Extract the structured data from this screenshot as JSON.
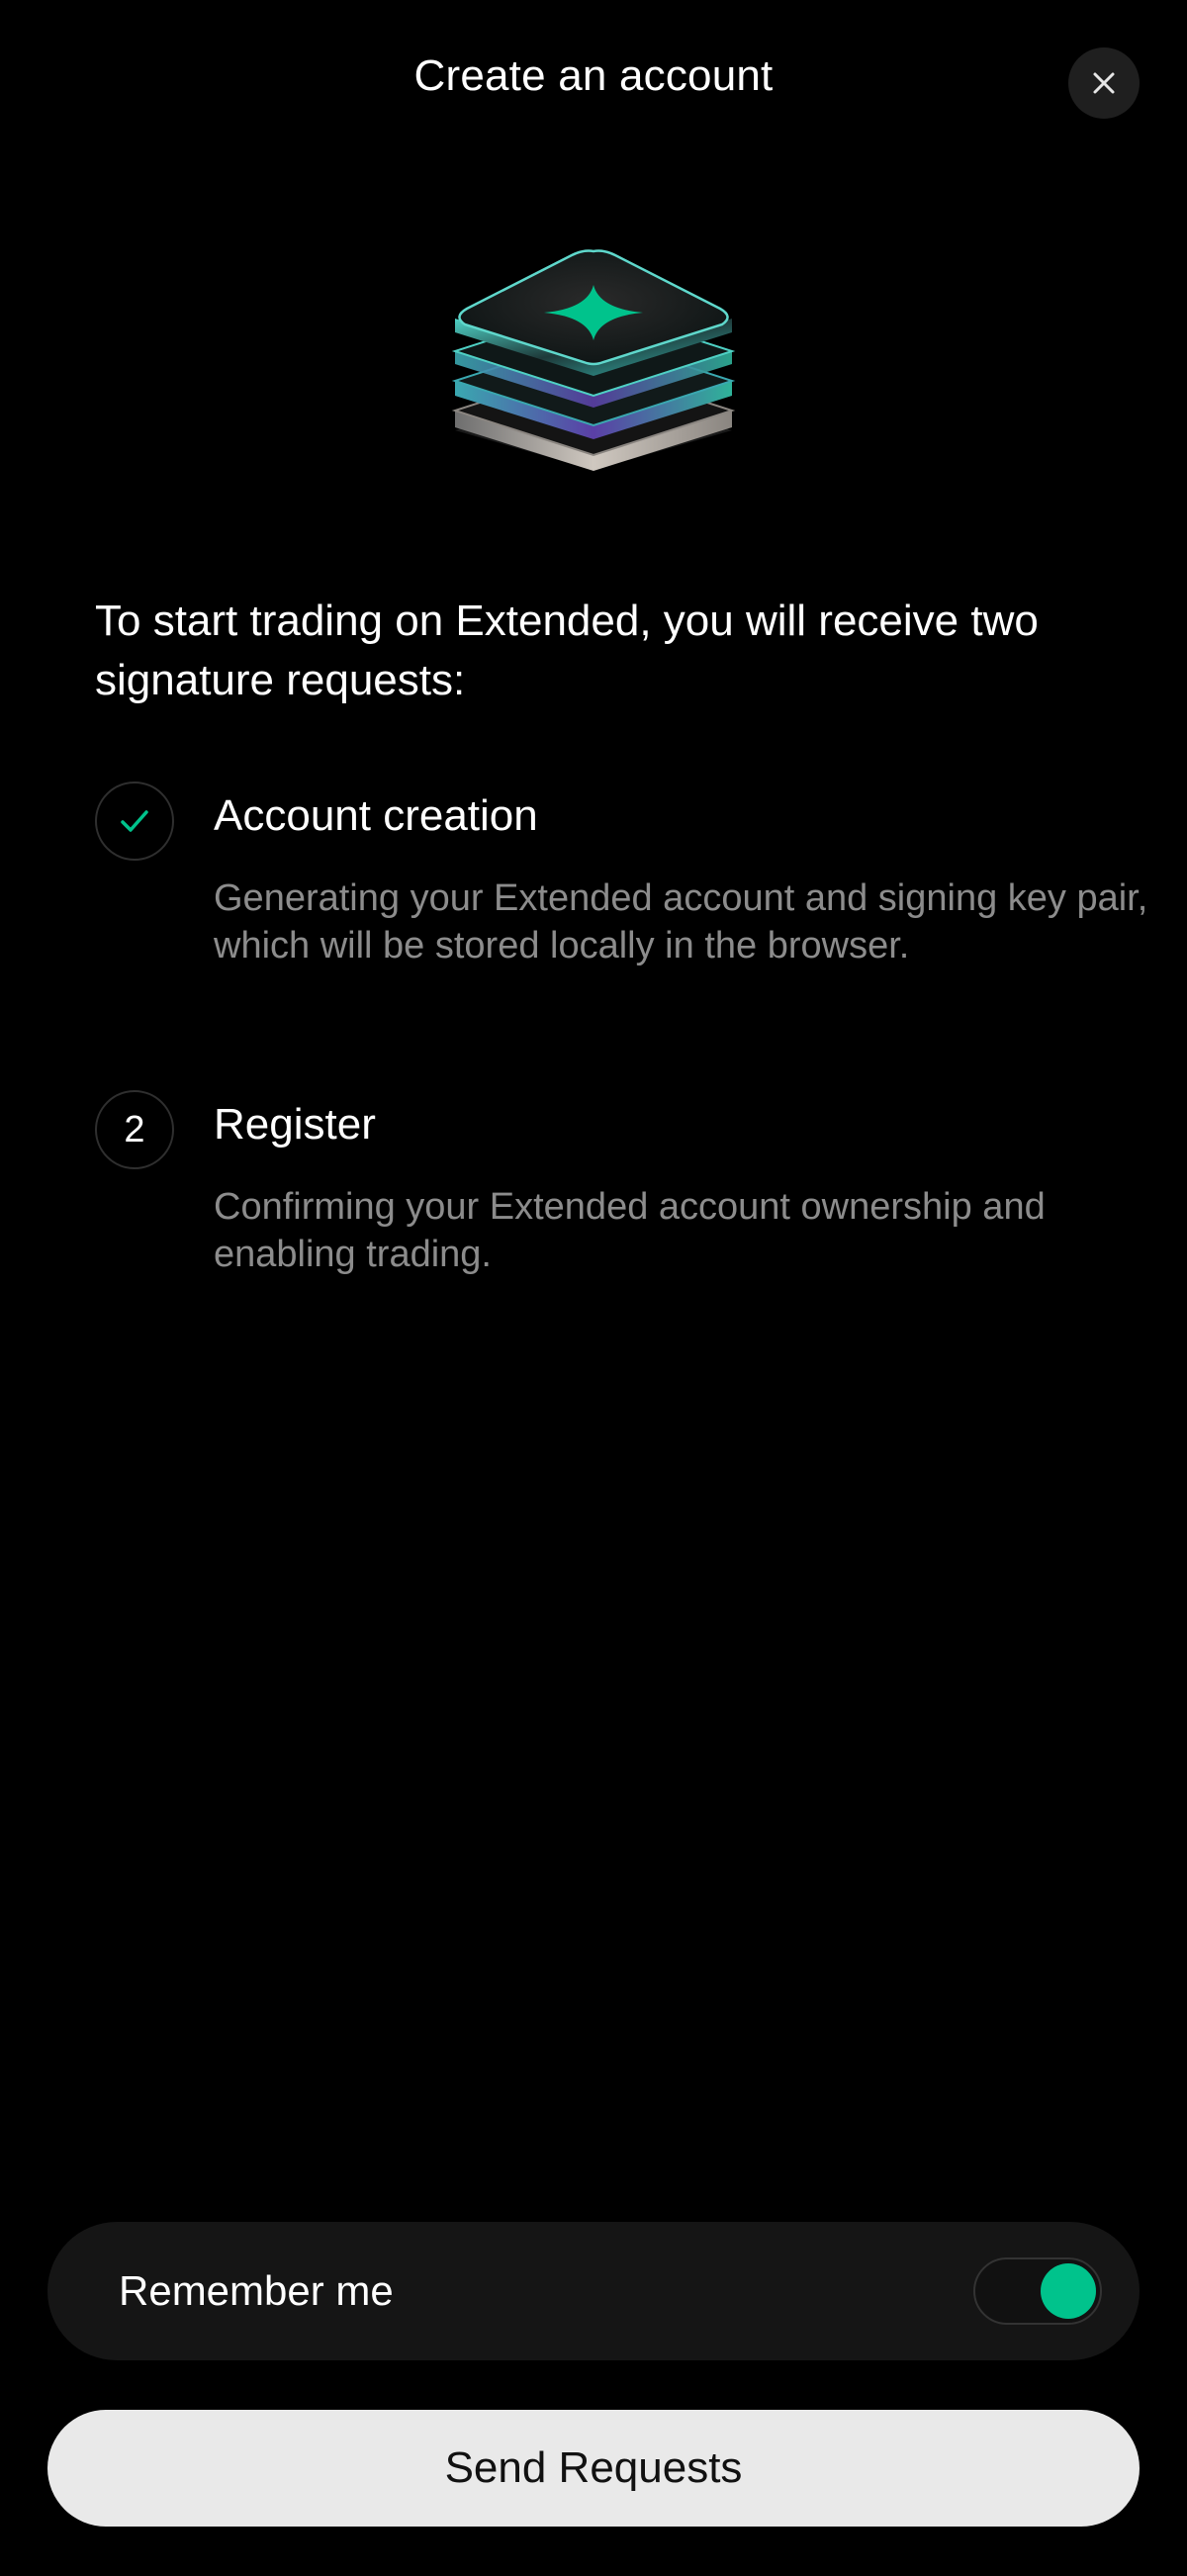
{
  "header": {
    "title": "Create an account",
    "close_icon": "close-icon"
  },
  "hero": {
    "icon": "stacked-layers-star-icon",
    "accent_color": "#00c38c"
  },
  "intro": {
    "text": "To start trading on Extended, you will receive two signature requests:"
  },
  "steps": [
    {
      "status": "completed",
      "icon": "checkmark-icon",
      "title": "Account creation",
      "description": "Generating your Extended account and signing key pair, which will be stored locally in the browser."
    },
    {
      "status": "pending",
      "number": "2",
      "title": "Register",
      "description": "Confirming your Extended account ownership and enabling trading."
    }
  ],
  "remember": {
    "label": "Remember me",
    "enabled": true
  },
  "actions": {
    "send_label": "Send Requests"
  },
  "colors": {
    "background": "#000000",
    "accent": "#00c38c",
    "muted_text": "#8c8c8c",
    "button_bg": "#e9e9e9"
  }
}
